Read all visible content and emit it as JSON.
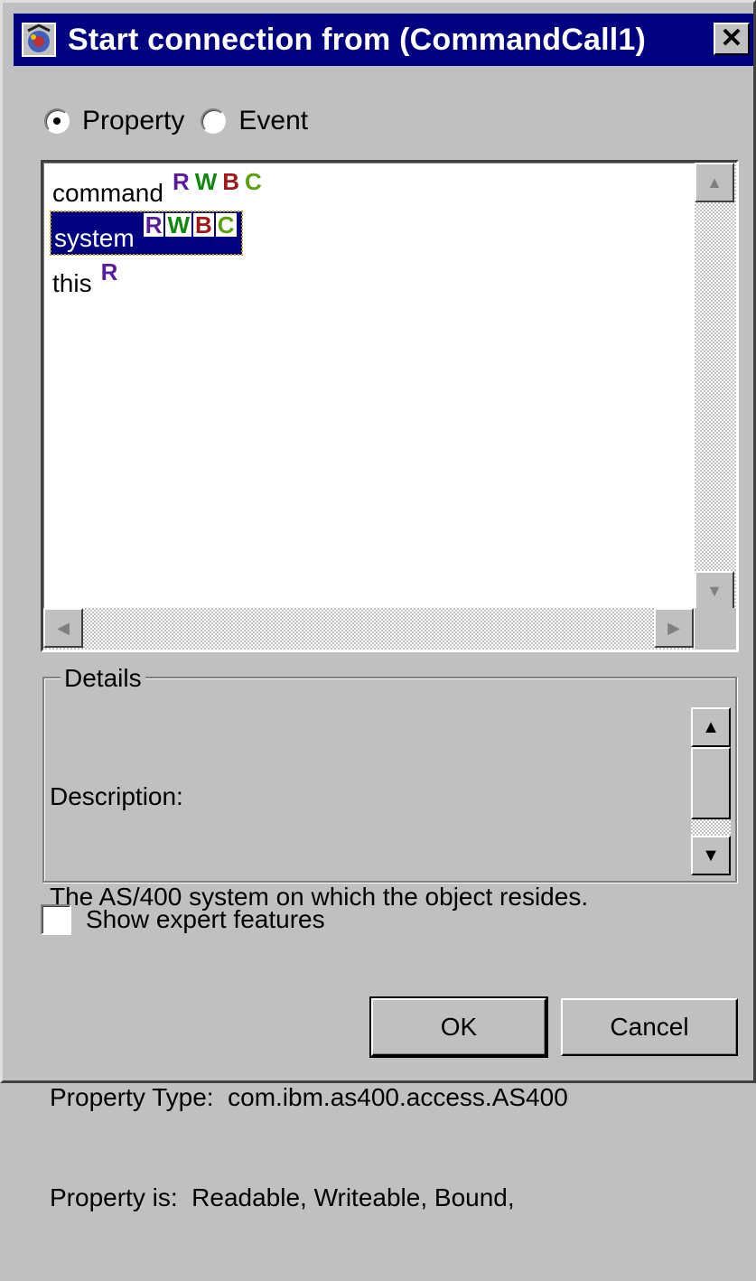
{
  "window": {
    "title": "Start connection from (CommandCall1)",
    "close_glyph": "✕",
    "icon": "beans-connect-icon"
  },
  "connection_type": {
    "options": [
      {
        "label": "Property",
        "selected": true
      },
      {
        "label": "Event",
        "selected": false
      }
    ]
  },
  "property_list": {
    "items": [
      {
        "name": "command",
        "flags": [
          "R",
          "W",
          "B",
          "C"
        ],
        "selected": false
      },
      {
        "name": "system",
        "flags": [
          "R",
          "W",
          "B",
          "C"
        ],
        "selected": true
      },
      {
        "name": "this",
        "flags": [
          "R"
        ],
        "selected": false
      }
    ]
  },
  "details": {
    "legend": "Details",
    "lines": [
      "Description:",
      "The AS/400 system on which the object resides.",
      "",
      "Property Type:  com.ibm.as400.access.AS400",
      "Property is:  Readable, Writeable, Bound,"
    ]
  },
  "show_expert": {
    "label": "Show expert features",
    "checked": false
  },
  "buttons": {
    "ok": "OK",
    "cancel": "Cancel"
  },
  "colors": {
    "title_bar": "#000080",
    "flag_R": "#5b1c9b",
    "flag_W": "#108810",
    "flag_B": "#a01818",
    "flag_C": "#5aa010"
  }
}
